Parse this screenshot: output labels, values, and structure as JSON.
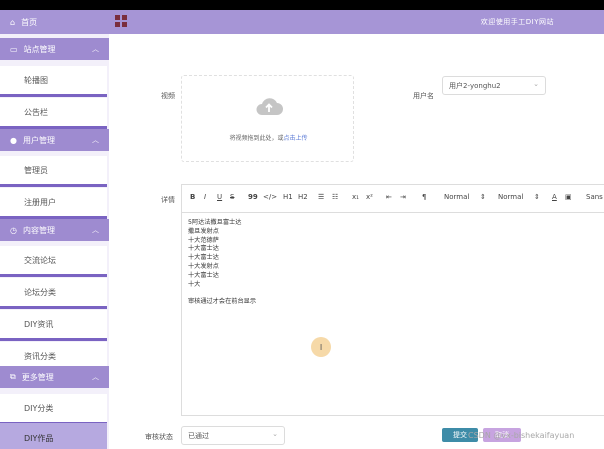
{
  "sidebar": {
    "home": "首页",
    "groups": [
      {
        "label": "站点管理",
        "items": [
          "轮播图",
          "公告栏"
        ]
      },
      {
        "label": "用户管理",
        "items": [
          "管理员",
          "注册用户"
        ]
      },
      {
        "label": "内容管理",
        "items": [
          "交流论坛",
          "论坛分类",
          "DIY资讯",
          "资讯分类"
        ]
      },
      {
        "label": "更多管理",
        "items": [
          "DIY分类",
          "DIY作品"
        ]
      }
    ]
  },
  "header": {
    "welcome": "欢迎使用手工DIY网站"
  },
  "form": {
    "video_label": "视频",
    "upload_text": "将视频拖到此处，或",
    "upload_link": "点击上传",
    "username_label": "用户名",
    "username_value": "用户2-yonghu2",
    "detail_label": "详情",
    "editor_lines": [
      "5阿达法撒旦富士达",
      "撒旦发射点",
      "十大范德萨",
      "十大富士达",
      "十大富士达",
      "十大发射点",
      "十大富士达",
      "十大",
      "",
      "审核通过才会在前台显示"
    ],
    "status_label": "审核状态",
    "status_value": "已通过",
    "submit": "提交",
    "cancel": "取消"
  },
  "toolbar": {
    "bold": "B",
    "italic": "I",
    "underline": "U",
    "strike": "S",
    "quote": "99",
    "code": "</>",
    "h1": "H1",
    "h2": "H2",
    "sub": "x₁",
    "sup": "x²",
    "dir": "¶",
    "size": "Normal",
    "header": "Normal",
    "font": "Sans"
  },
  "watermark": "CSDN @vx-bishekaifayuan",
  "colors": {
    "accent": "#a695d6",
    "submit": "#3e8ca8",
    "cancel": "#c7a4e0"
  }
}
